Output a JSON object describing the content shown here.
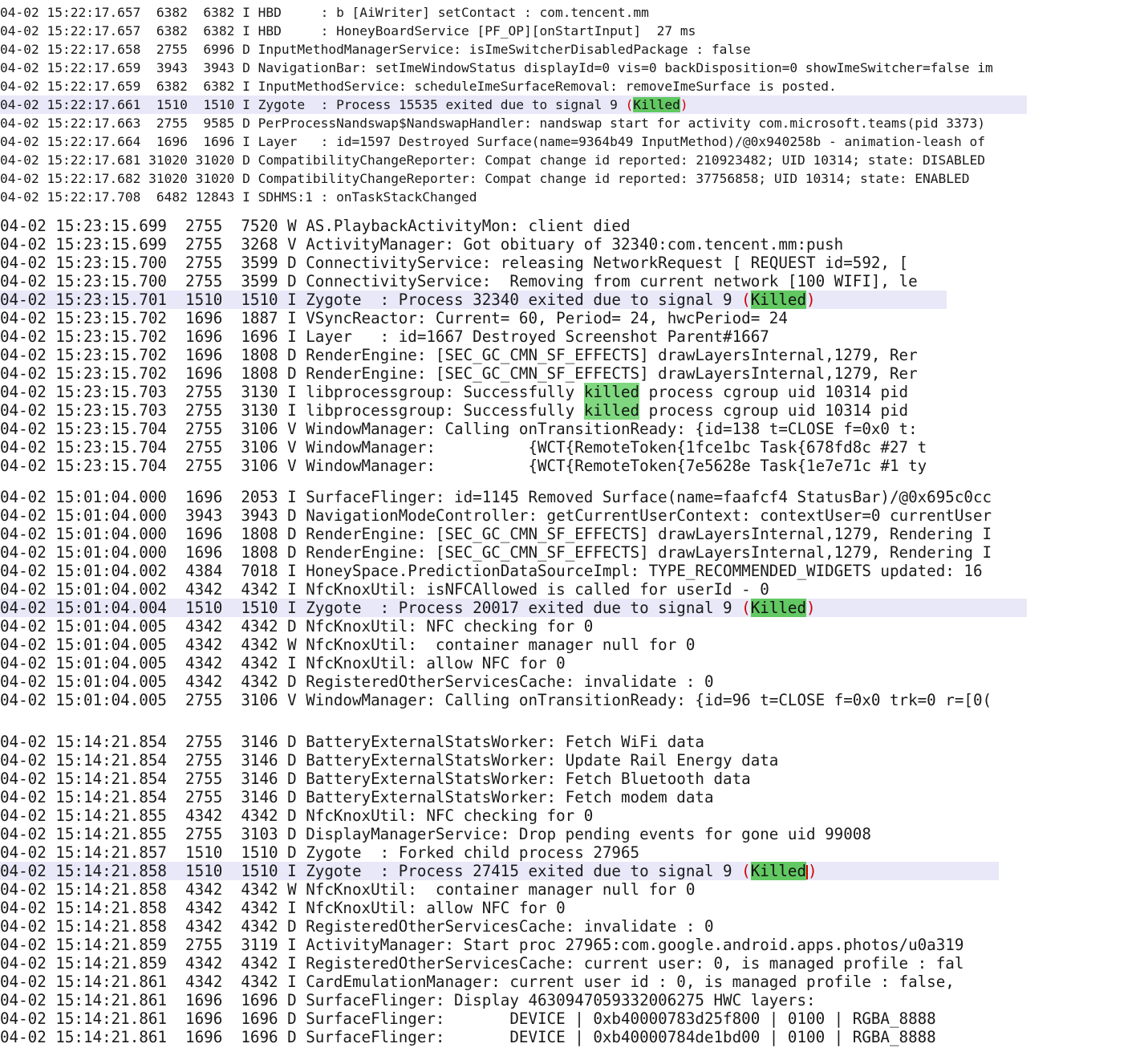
{
  "log_blocks": [
    {
      "lines": [
        {
          "text": "04-02 15:22:17.657  6382  6382 I HBD     : b [AiWriter] setContact : com.tencent.mm"
        },
        {
          "text": "04-02 15:22:17.657  6382  6382 I HBD     : HoneyBoardService [PF_OP][onStartInput]  27 ms"
        },
        {
          "text": "04-02 15:22:17.658  2755  6996 D InputMethodManagerService: isImeSwitcherDisabledPackage : false"
        },
        {
          "text": "04-02 15:22:17.659  3943  3943 D NavigationBar: setImeWindowStatus displayId=0 vis=0 backDisposition=0 showImeSwitcher=false im"
        },
        {
          "text": "04-02 15:22:17.659  6382  6382 I InputMethodService: scheduleImeSurfaceRemoval: removeImeSurface is posted."
        },
        {
          "text": "04-02 15:22:17.661  1510  1510 I Zygote  : Process 15535 exited due to signal 9 ",
          "kw": "Killed",
          "highlight": true
        },
        {
          "text": "04-02 15:22:17.663  2755  9585 D PerProcessNandswap$NandswapHandler: nandswap start for activity com.microsoft.teams(pid 3373)"
        },
        {
          "text": "04-02 15:22:17.664  1696  1696 I Layer   : id=1597 Destroyed Surface(name=9364b49 InputMethod)/@0x940258b - animation-leash of"
        },
        {
          "text": "04-02 15:22:17.681 31020 31020 D CompatibilityChangeReporter: Compat change id reported: 210923482; UID 10314; state: DISABLED"
        },
        {
          "text": "04-02 15:22:17.682 31020 31020 D CompatibilityChangeReporter: Compat change id reported: 37756858; UID 10314; state: ENABLED"
        },
        {
          "text": "04-02 15:22:17.708  6482 12843 I SDHMS:1 : onTaskStackChanged"
        }
      ]
    },
    {
      "lines": [
        {
          "text": "04-02 15:23:15.699  2755  7520 W AS.PlaybackActivityMon: client died"
        },
        {
          "text": "04-02 15:23:15.699  2755  3268 V ActivityManager: Got obituary of 32340:com.tencent.mm:push"
        },
        {
          "text": "04-02 15:23:15.700  2755  3599 D ConnectivityService: releasing NetworkRequest [ REQUEST id=592, ["
        },
        {
          "text": "04-02 15:23:15.700  2755  3599 D ConnectivityService:  Removing from current network [100 WIFI], le"
        },
        {
          "text": "04-02 15:23:15.701  1510  1510 I Zygote  : Process 32340 exited due to signal 9 ",
          "kw": "Killed",
          "highlight": true
        },
        {
          "text": "04-02 15:23:15.702  1696  1887 I VSyncReactor: Current= 60, Period= 24, hwcPeriod= 24"
        },
        {
          "text": "04-02 15:23:15.702  1696  1696 I Layer   : id=1667 Destroyed Screenshot Parent#1667"
        },
        {
          "text": "04-02 15:23:15.702  1696  1808 D RenderEngine: [SEC_GC_CMN_SF_EFFECTS] drawLayersInternal,1279, Rer"
        },
        {
          "text": "04-02 15:23:15.702  1696  1808 D RenderEngine: [SEC_GC_CMN_SF_EFFECTS] drawLayersInternal,1279, Rer"
        },
        {
          "text": "04-02 15:23:15.703  2755  3130 I libprocessgroup: Successfully ",
          "kw": "killed",
          "after": " process cgroup uid 10314 pid"
        },
        {
          "text": "04-02 15:23:15.703  2755  3130 I libprocessgroup: Successfully ",
          "kw": "killed",
          "after": " process cgroup uid 10314 pid"
        },
        {
          "text": "04-02 15:23:15.704  2755  3106 V WindowManager: Calling onTransitionReady: {id=138 t=CLOSE f=0x0 t:"
        },
        {
          "text": "04-02 15:23:15.704  2755  3106 V WindowManager:          {WCT{RemoteToken{1fce1bc Task{678fd8c #27 t"
        },
        {
          "text": "04-02 15:23:15.704  2755  3106 V WindowManager:          {WCT{RemoteToken{7e5628e Task{1e7e71c #1 ty"
        }
      ]
    },
    {
      "lines": [
        {
          "text": "04-02 15:01:04.000  1696  2053 I SurfaceFlinger: id=1145 Removed Surface(name=faafcf4 StatusBar)/@0x695c0cc"
        },
        {
          "text": "04-02 15:01:04.000  3943  3943 D NavigationModeController: getCurrentUserContext: contextUser=0 currentUser"
        },
        {
          "text": "04-02 15:01:04.000  1696  1808 D RenderEngine: [SEC_GC_CMN_SF_EFFECTS] drawLayersInternal,1279, Rendering I"
        },
        {
          "text": "04-02 15:01:04.000  1696  1808 D RenderEngine: [SEC_GC_CMN_SF_EFFECTS] drawLayersInternal,1279, Rendering I"
        },
        {
          "text": "04-02 15:01:04.002  4384  7018 I HoneySpace.PredictionDataSourceImpl: TYPE_RECOMMENDED_WIDGETS updated: 16"
        },
        {
          "text": "04-02 15:01:04.002  4342  4342 I NfcKnoxUtil: isNFCAllowed is called for userId - 0"
        },
        {
          "text": "04-02 15:01:04.004  1510  1510 I Zygote  : Process 20017 exited due to signal 9 ",
          "kw": "Killed",
          "highlight": true
        },
        {
          "text": "04-02 15:01:04.005  4342  4342 D NfcKnoxUtil: NFC checking for 0"
        },
        {
          "text": "04-02 15:01:04.005  4342  4342 W NfcKnoxUtil:  container manager null for 0"
        },
        {
          "text": "04-02 15:01:04.005  4342  4342 I NfcKnoxUtil: allow NFC for 0"
        },
        {
          "text": "04-02 15:01:04.005  4342  4342 D RegisteredOtherServicesCache: invalidate : 0"
        },
        {
          "text": "04-02 15:01:04.005  2755  3106 V WindowManager: Calling onTransitionReady: {id=96 t=CLOSE f=0x0 trk=0 r=[0("
        }
      ]
    },
    {
      "lines": [
        {
          "text": "04-02 15:14:21.854  2755  3146 D BatteryExternalStatsWorker: Fetch WiFi data"
        },
        {
          "text": "04-02 15:14:21.854  2755  3146 D BatteryExternalStatsWorker: Update Rail Energy data"
        },
        {
          "text": "04-02 15:14:21.854  2755  3146 D BatteryExternalStatsWorker: Fetch Bluetooth data"
        },
        {
          "text": "04-02 15:14:21.854  2755  3146 D BatteryExternalStatsWorker: Fetch modem data"
        },
        {
          "text": "04-02 15:14:21.855  4342  4342 D NfcKnoxUtil: NFC checking for 0"
        },
        {
          "text": "04-02 15:14:21.855  2755  3103 D DisplayManagerService: Drop pending events for gone uid 99008"
        },
        {
          "text": "04-02 15:14:21.857  1510  1510 D Zygote  : Forked child process 27965"
        },
        {
          "text": "04-02 15:14:21.858  1510  1510 I Zygote  : Process 27415 exited due to signal 9 ",
          "kw": "Killed",
          "highlight": true,
          "caret": true
        },
        {
          "text": "04-02 15:14:21.858  4342  4342 W NfcKnoxUtil:  container manager null for 0"
        },
        {
          "text": "04-02 15:14:21.858  4342  4342 I NfcKnoxUtil: allow NFC for 0"
        },
        {
          "text": "04-02 15:14:21.858  4342  4342 D RegisteredOtherServicesCache: invalidate : 0"
        },
        {
          "text": "04-02 15:14:21.859  2755  3119 I ActivityManager: Start proc 27965:com.google.android.apps.photos/u0a319"
        },
        {
          "text": "04-02 15:14:21.859  4342  4342 I RegisteredOtherServicesCache: current user: 0, is managed profile : fal"
        },
        {
          "text": "04-02 15:14:21.861  4342  4342 I CardEmulationManager: current user id : 0, is managed profile : false,"
        },
        {
          "text": "04-02 15:14:21.861  1696  1696 D SurfaceFlinger: Display 4630947059332006275 HWC layers:"
        },
        {
          "text": "04-02 15:14:21.861  1696  1696 D SurfaceFlinger:       DEVICE | 0xb40000783d25f800 | 0100 | RGBA_8888"
        },
        {
          "text": "04-02 15:14:21.861  1696  1696 D SurfaceFlinger:       DEVICE | 0xb40000784de1bd00 | 0100 | RGBA_8888"
        }
      ]
    }
  ]
}
